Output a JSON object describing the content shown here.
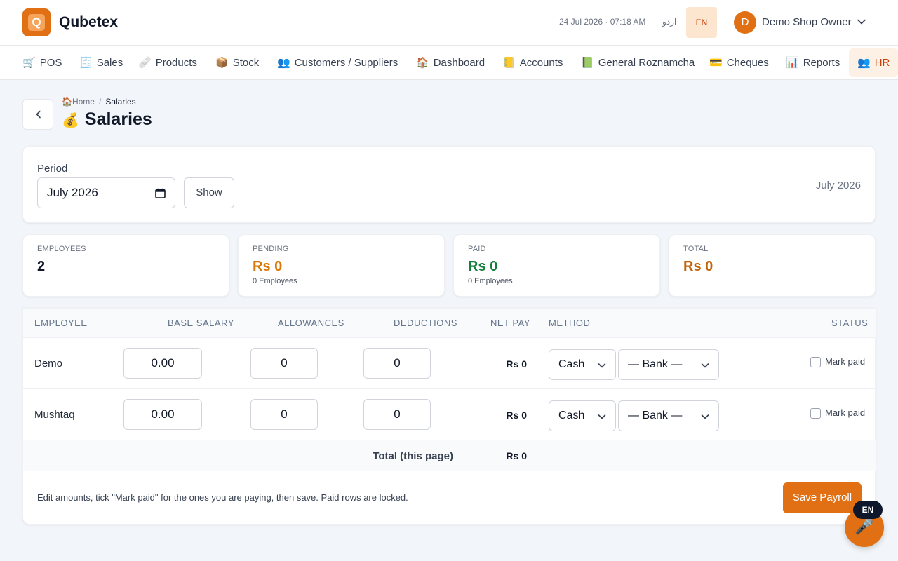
{
  "app": {
    "brand_letter": "Q",
    "brand_name": "Qubetex",
    "datetime": "24 Jul 2026 · 07:18 AM",
    "lang_urdu": "اردو",
    "lang_en": "EN",
    "user_initial": "D",
    "user_name": "Demo Shop Owner"
  },
  "nav": [
    {
      "icon": "🛒",
      "label": "POS"
    },
    {
      "icon": "🧾",
      "label": "Sales"
    },
    {
      "icon": "🩹",
      "label": "Products"
    },
    {
      "icon": "📦",
      "label": "Stock"
    },
    {
      "icon": "👥",
      "label": "Customers / Suppliers"
    },
    {
      "icon": "🏠",
      "label": "Dashboard"
    },
    {
      "icon": "📒",
      "label": "Accounts"
    },
    {
      "icon": "📗",
      "label": "General Roznamcha"
    },
    {
      "icon": "💳",
      "label": "Cheques"
    },
    {
      "icon": "📊",
      "label": "Reports"
    },
    {
      "icon": "👥",
      "label": "HR"
    }
  ],
  "breadcrumb": {
    "home_icon": "🏠",
    "home": "Home",
    "separator": "/",
    "current": "Salaries"
  },
  "page": {
    "icon": "💰",
    "title": "Salaries"
  },
  "period": {
    "label": "Period",
    "value": "July 2026",
    "show_label": "Show",
    "display": "July 2026"
  },
  "stats": {
    "employees": {
      "label": "EMPLOYEES",
      "value": "2"
    },
    "pending": {
      "label": "PENDING",
      "value": "Rs 0",
      "sub": "0 Employees"
    },
    "paid": {
      "label": "PAID",
      "value": "Rs 0",
      "sub": "0 Employees"
    },
    "total": {
      "label": "TOTAL",
      "value": "Rs 0"
    }
  },
  "table": {
    "headers": {
      "employee": "EMPLOYEE",
      "base_salary": "BASE SALARY",
      "allowances": "ALLOWANCES",
      "deductions": "DEDUCTIONS",
      "net_pay": "NET PAY",
      "method": "METHOD",
      "status": "STATUS"
    },
    "rows": [
      {
        "employee": "Demo",
        "base_salary": "0.00",
        "allowances": "0",
        "deductions": "0",
        "net_pay": "Rs 0",
        "method": "Cash",
        "bank": "— Bank —",
        "status_label": "Mark paid"
      },
      {
        "employee": "Mushtaq",
        "base_salary": "0.00",
        "allowances": "0",
        "deductions": "0",
        "net_pay": "Rs 0",
        "method": "Cash",
        "bank": "— Bank —",
        "status_label": "Mark paid"
      }
    ],
    "total_label": "Total (this page)",
    "total_value": "Rs 0"
  },
  "footer": {
    "note": "Edit amounts, tick \"Mark paid\" for the ones you are paying, then save. Paid rows are locked.",
    "save_label": "Save Payroll"
  },
  "voice": {
    "lang": "EN",
    "icon": "🎤"
  },
  "colors": {
    "accent": "#e07013",
    "pending": "#d97706",
    "paid": "#15803d",
    "total": "#c2630a"
  }
}
